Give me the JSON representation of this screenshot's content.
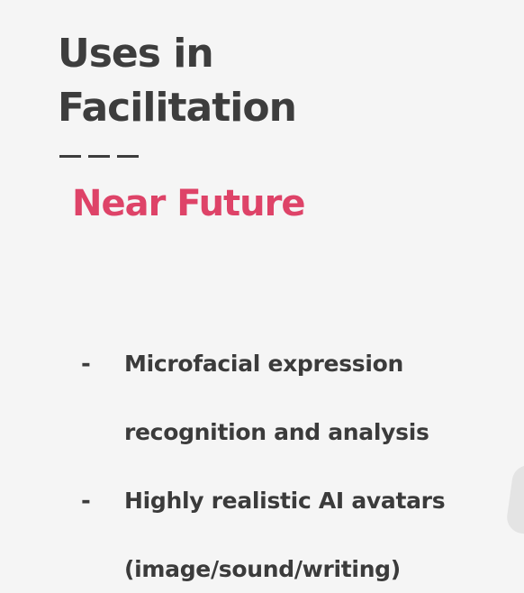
{
  "slide": {
    "title_line1": "Uses in",
    "title_line2": "Facilitation",
    "subtitle": "Near Future",
    "bullet_marker": "-",
    "bullets": [
      {
        "line1": "Microfacial expression",
        "line2": "recognition and analysis"
      },
      {
        "line1": "Highly realistic AI avatars",
        "line2": "(image/sound/writing)"
      }
    ]
  },
  "colors": {
    "background": "#f5f5f5",
    "title_text": "#3d3d3d",
    "accent": "#de4368",
    "body_text": "#3b3b3b"
  }
}
